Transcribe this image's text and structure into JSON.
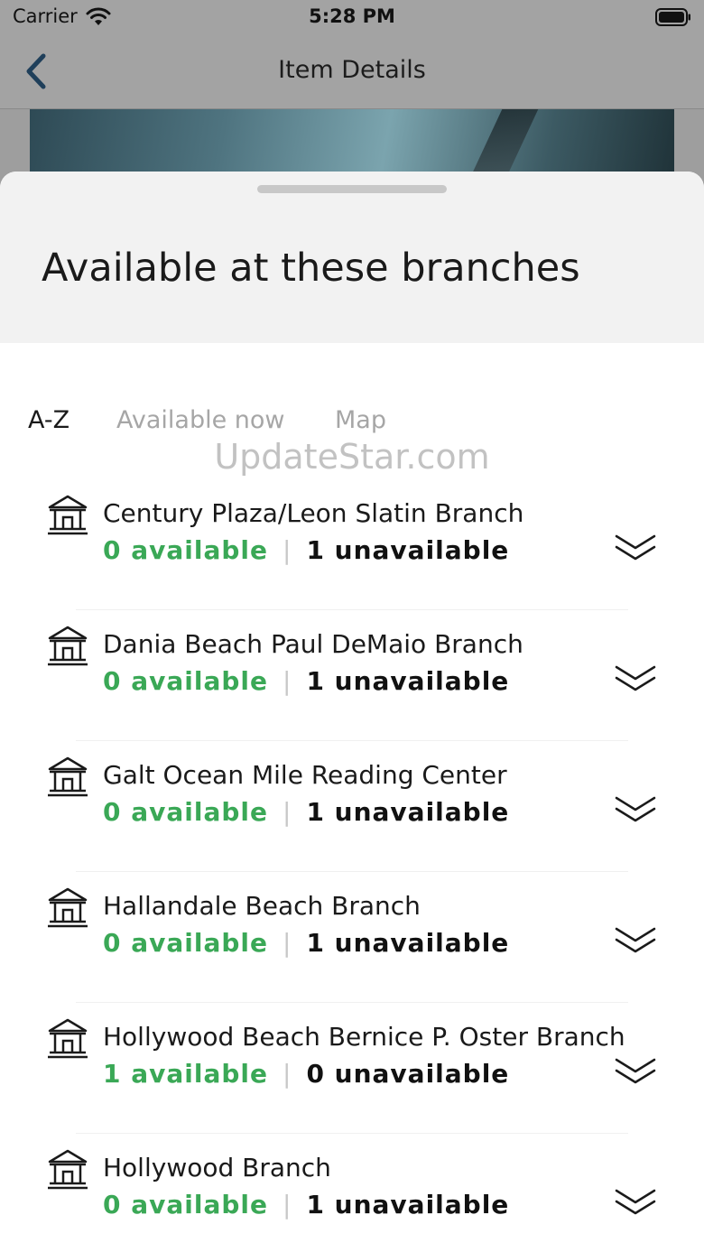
{
  "status_bar": {
    "carrier": "Carrier",
    "time": "5:28 PM"
  },
  "nav": {
    "title": "Item Details"
  },
  "sheet": {
    "title": "Available at these branches",
    "tabs": [
      {
        "label": "A-Z",
        "active": true
      },
      {
        "label": "Available now",
        "active": false
      },
      {
        "label": "Map",
        "active": false
      }
    ],
    "branches": [
      {
        "name": "Century Plaza/Leon Slatin Branch",
        "available": "0 available",
        "unavailable": "1 unavailable"
      },
      {
        "name": "Dania Beach Paul DeMaio Branch",
        "available": "0 available",
        "unavailable": "1 unavailable"
      },
      {
        "name": "Galt Ocean Mile Reading Center",
        "available": "0 available",
        "unavailable": "1 unavailable"
      },
      {
        "name": "Hallandale Beach Branch",
        "available": "0 available",
        "unavailable": "1 unavailable"
      },
      {
        "name": "Hollywood Beach Bernice P. Oster Branch",
        "available": "1 available",
        "unavailable": "0 unavailable"
      },
      {
        "name": "Hollywood Branch",
        "available": "0 available",
        "unavailable": "1 unavailable"
      }
    ]
  },
  "watermark": "UpdateStar.com",
  "colors": {
    "available": "#3aa856",
    "text": "#1a1a1a",
    "tab_inactive": "#a6a6a6",
    "back_arrow": "#1f3f5a"
  }
}
